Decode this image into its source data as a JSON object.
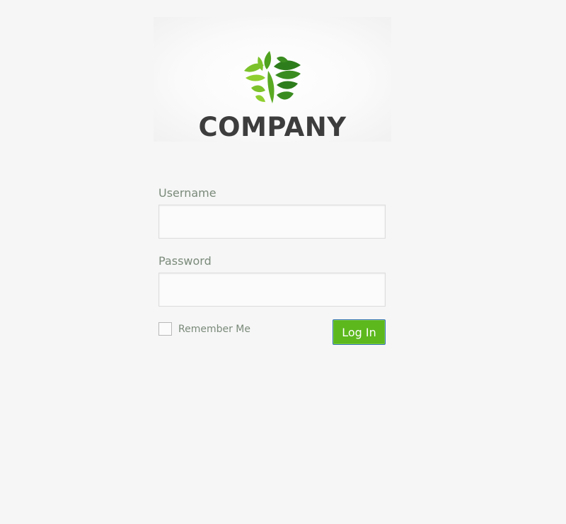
{
  "logo": {
    "text": "COMPANY",
    "icon": "leaf-pentagon-logo-icon",
    "colors": {
      "light_green": "#7cc22b",
      "mid_green": "#4fa21f",
      "dark_green": "#2e7d1c",
      "text": "#3d3d3d"
    }
  },
  "form": {
    "username": {
      "label": "Username",
      "value": "",
      "placeholder": ""
    },
    "password": {
      "label": "Password",
      "value": "",
      "placeholder": ""
    },
    "remember": {
      "label": "Remember Me",
      "checked": false
    },
    "login_label": "Log In"
  },
  "colors": {
    "background": "#f6f6f6",
    "button": "#5cb81d",
    "button_border": "#2f6fb0",
    "label": "#7a8a7a"
  }
}
